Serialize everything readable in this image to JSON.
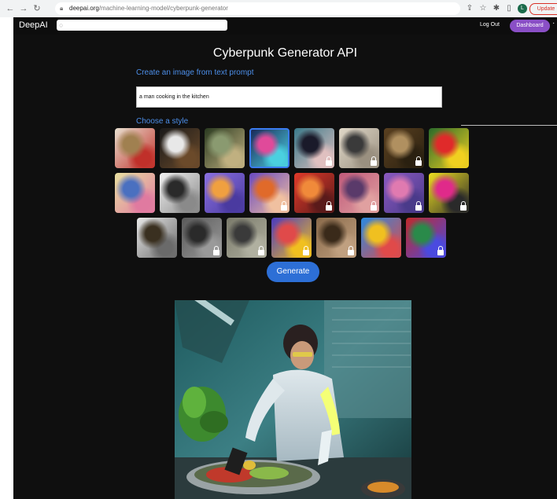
{
  "browser": {
    "url_host": "deepai.org",
    "url_path": "/machine-learning-model/cyberpunk-generator",
    "profile_initial": "L",
    "update_label": "Update"
  },
  "header": {
    "logo": "DeepAI",
    "logout_label": "Log Out",
    "dashboard_label": "Dashboard"
  },
  "main": {
    "title": "Cyberpunk Generator API",
    "subtitle": "Create an image from text prompt",
    "prompt_value": "a man cooking in the kitchen",
    "choose_style": "Choose a style",
    "generate_label": "Generate"
  },
  "styles": [
    {
      "colors": [
        "#e8e0d0",
        "#a08050",
        "#c0302a"
      ],
      "locked": false
    },
    {
      "colors": [
        "#1a1a1a",
        "#e8e8e8",
        "#6b4a2a"
      ],
      "locked": false
    },
    {
      "colors": [
        "#2a3a20",
        "#8a9a70",
        "#c0b080"
      ],
      "locked": false
    },
    {
      "colors": [
        "#1a2a5a",
        "#e04a9a",
        "#4ad0e0"
      ],
      "locked": false
    },
    {
      "colors": [
        "#3a7a8a",
        "#1a1a2a",
        "#e0c0c0"
      ],
      "locked": true
    },
    {
      "colors": [
        "#e0d8c8",
        "#3a3a3a",
        "#9a9080"
      ],
      "locked": true
    },
    {
      "colors": [
        "#5a4020",
        "#b09060",
        "#2a2010"
      ],
      "locked": true
    },
    {
      "colors": [
        "#2a6a2a",
        "#e02a2a",
        "#f0d020"
      ],
      "locked": false
    },
    {
      "colors": [
        "#e8e0a0",
        "#4a70c0",
        "#e07aa0"
      ],
      "locked": false
    },
    {
      "colors": [
        "#f0f0f0",
        "#2a2a2a",
        "#8a8a8a"
      ],
      "locked": false
    },
    {
      "colors": [
        "#8a70e0",
        "#f0a040",
        "#4a3aa0"
      ],
      "locked": false
    },
    {
      "colors": [
        "#6a4ac0",
        "#e06a2a",
        "#f0c0a0"
      ],
      "locked": true
    },
    {
      "colors": [
        "#e03a2a",
        "#f08a3a",
        "#5a1a1a"
      ],
      "locked": true
    },
    {
      "colors": [
        "#c05a7a",
        "#5a3a6a",
        "#e0a0a0"
      ],
      "locked": true
    },
    {
      "colors": [
        "#8a5ac0",
        "#e07ab0",
        "#4a3a8a"
      ],
      "locked": true
    },
    {
      "colors": [
        "#f0e020",
        "#e02a8a",
        "#2a2a2a"
      ],
      "locked": true
    },
    {
      "colors": [
        "#e8e8e8",
        "#3a3020",
        "#6a6a6a"
      ],
      "locked": false
    },
    {
      "colors": [
        "#5a5a5a",
        "#2a2a2a",
        "#9a9a9a"
      ],
      "locked": true
    },
    {
      "colors": [
        "#7a7a6a",
        "#3a3a3a",
        "#b0b0a0"
      ],
      "locked": true
    },
    {
      "colors": [
        "#4a3ac0",
        "#e04a4a",
        "#f0c020"
      ],
      "locked": true
    },
    {
      "colors": [
        "#8a6a4a",
        "#3a2a1a",
        "#c0a080"
      ],
      "locked": true
    },
    {
      "colors": [
        "#2a8ae0",
        "#f0c020",
        "#e04a4a"
      ],
      "locked": false
    },
    {
      "colors": [
        "#c02a2a",
        "#2a8a4a",
        "#4a4ae0"
      ],
      "locked": true
    }
  ]
}
